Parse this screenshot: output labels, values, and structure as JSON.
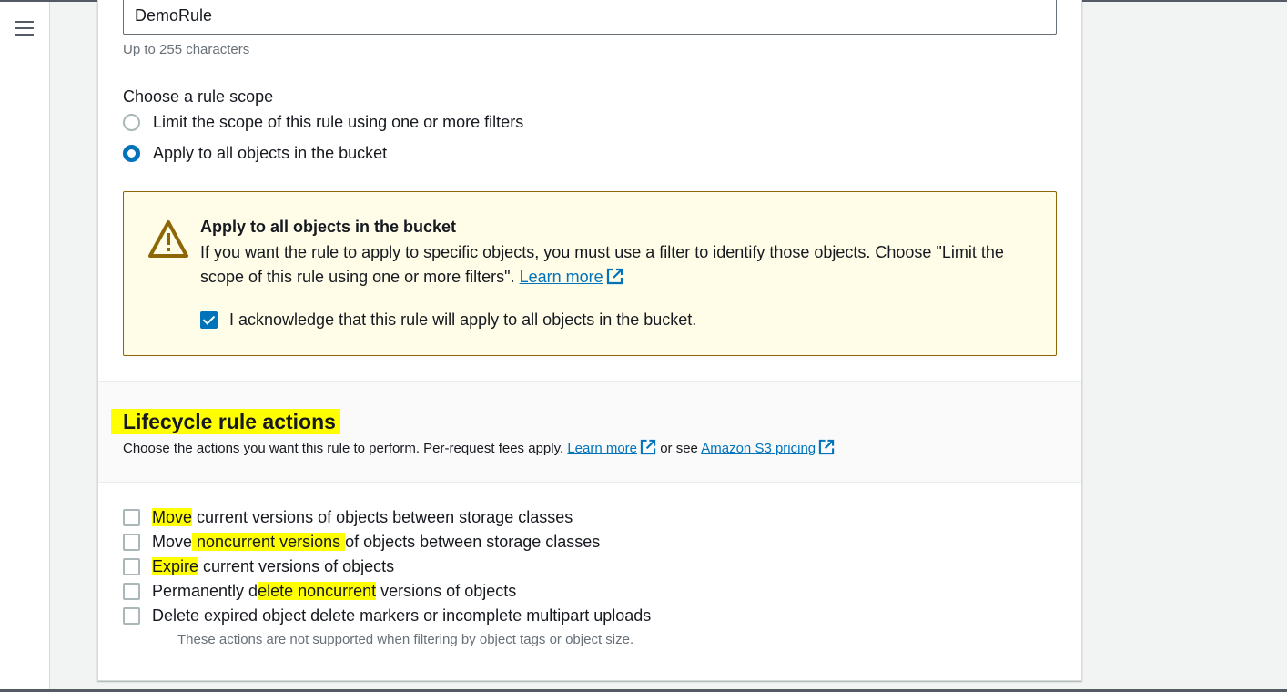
{
  "nav": {
    "menu_icon": "hamburger-menu-icon"
  },
  "rule_name": {
    "value": "DemoRule",
    "hint": "Up to 255 characters"
  },
  "scope": {
    "label": "Choose a rule scope",
    "options": [
      {
        "label": "Limit the scope of this rule using one or more filters",
        "selected": false
      },
      {
        "label": "Apply to all objects in the bucket",
        "selected": true
      }
    ]
  },
  "alert": {
    "icon": "warning-icon",
    "title": "Apply to all objects in the bucket",
    "body": "If you want the rule to apply to specific objects, you must use a filter to identify those objects. Choose \"Limit the scope of this rule using one or more filters\".",
    "learn_more": "Learn more",
    "ack_label": "I acknowledge that this rule will apply to all objects in the bucket.",
    "ack_checked": true
  },
  "actions_section": {
    "title": "Lifecycle rule actions",
    "desc_prefix": "Choose the actions you want this rule to perform. Per-request fees apply.",
    "learn_more": "Learn more",
    "or_see": "or see",
    "pricing_link": "Amazon S3 pricing"
  },
  "actions": [
    {
      "pre": "",
      "hl": "Move",
      "post": " current versions of objects between storage classes",
      "checked": false
    },
    {
      "pre": "Move",
      "hl": " noncurrent versions ",
      "post": "of objects between storage classes",
      "checked": false
    },
    {
      "pre": "",
      "hl": "Expire",
      "post": " current versions of objects",
      "checked": false
    },
    {
      "pre": "Permanently d",
      "hl": "elete noncurrent",
      "post": " versions of objects",
      "checked": false
    },
    {
      "pre": "Delete expired object delete markers or incomplete multipart uploads",
      "hl": "",
      "post": "",
      "checked": false
    }
  ],
  "actions_note": "These actions are not supported when filtering by object tags or object size.",
  "colors": {
    "highlight": "#ffff00",
    "link": "#0073bb",
    "warning": "#8d6605",
    "alert_bg": "#fffce8"
  }
}
